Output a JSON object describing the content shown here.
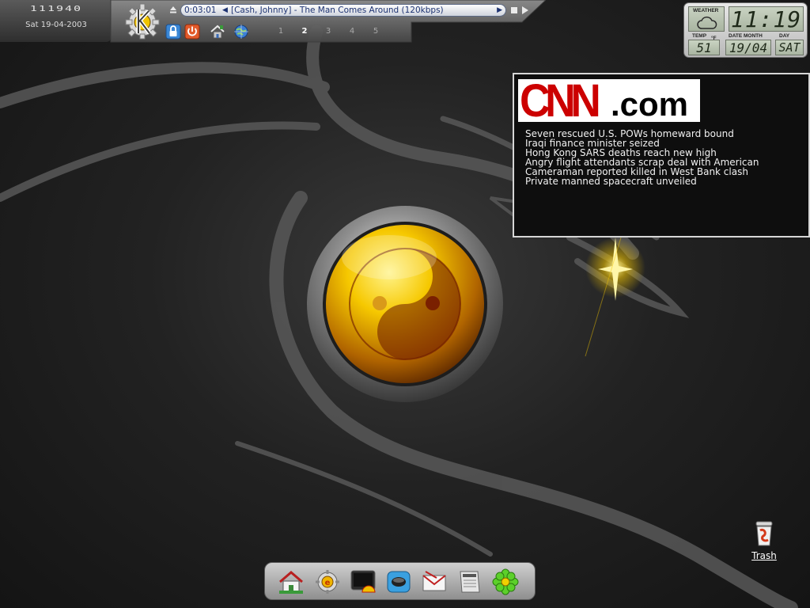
{
  "clock": {
    "time_digits": "111940",
    "date": "Sat 19-04-2003"
  },
  "media_player": {
    "time": "0:03:01",
    "prev_glyph": "◀",
    "track": "[Cash, Johnny] - The Man Comes Around (120kbps)",
    "next_glyph": "▶"
  },
  "pager": {
    "desktops": [
      "1",
      "2",
      "3",
      "4",
      "5"
    ],
    "active": "2"
  },
  "weather_widget": {
    "weather_label": "WEATHER",
    "time": "11:19",
    "temp_label": "TEMP",
    "temp_value": "51",
    "temp_unit": "°F",
    "date_label": "DATE MONTH",
    "date_value": "19/04",
    "day_label": "DAY",
    "day_value": "SAT"
  },
  "cnn": {
    "logo_cnn": "CNN",
    "logo_dotcom": ".com",
    "headlines": [
      "Seven rescued U.S. POWs homeward bound",
      "Iraqi finance minister seized",
      "Hong Kong SARS deaths reach new high",
      "Angry flight attendants scrap deal with American",
      "Cameraman reported killed in West Bank clash",
      "Private manned spacecraft unveiled"
    ]
  },
  "desktop_icons": {
    "trash_label": "Trash"
  },
  "dock": {
    "icons": [
      "home-icon",
      "kde-settings-icon",
      "terminal-shell-icon",
      "network-icon",
      "mail-icon",
      "news-icon",
      "icq-flower-icon"
    ]
  },
  "colors": {
    "cnn_red": "#cc0000",
    "media_text": "#1d3372",
    "emblem_yellow": "#f6c800"
  }
}
